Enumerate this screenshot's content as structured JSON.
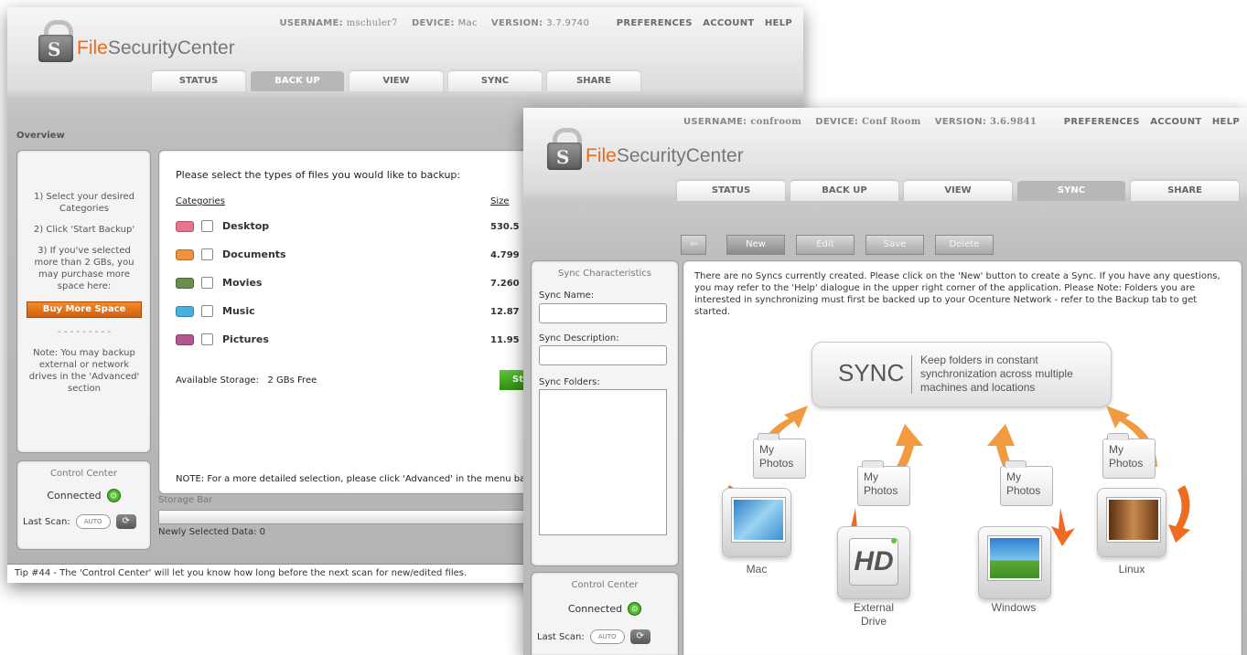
{
  "brand": {
    "prefix": "File",
    "suffix": "SecurityCenter"
  },
  "back_window": {
    "topbar": {
      "username_label": "USERNAME:",
      "username": "mschuler7",
      "device_label": "DEVICE:",
      "device": "Mac",
      "version_label": "VERSION:",
      "version": "3.7.9740",
      "preferences": "PREFERENCES",
      "account": "ACCOUNT",
      "help": "HELP"
    },
    "tabs": [
      "STATUS",
      "BACK UP",
      "VIEW",
      "SYNC",
      "SHARE"
    ],
    "active_tab": "BACK UP",
    "section_title": "Overview",
    "instructions": {
      "step1": "1) Select your desired Categories",
      "step2": "2) Click 'Start Backup'",
      "step3": "3) If you've selected more than 2 GBs, you may purchase more space here:",
      "buy_button": "Buy More Space",
      "divider": "- - - - - - - - -",
      "note": "Note: You may backup external or network drives in the 'Advanced' section"
    },
    "main": {
      "prompt": "Please select the types of files you would like to backup:",
      "categories_header": "Categories",
      "size_header": "Size",
      "categories": [
        {
          "name": "Desktop",
          "size": "530.5",
          "color": "#e8738f"
        },
        {
          "name": "Documents",
          "size": "4.799",
          "color": "#f0923d"
        },
        {
          "name": "Movies",
          "size": "7.260",
          "color": "#6a8d4e"
        },
        {
          "name": "Music",
          "size": "12.87",
          "color": "#46b2dc"
        },
        {
          "name": "Pictures",
          "size": "11.95",
          "color": "#b4558d"
        }
      ],
      "available_label": "Available Storage:",
      "available_value": "2 GBs Free",
      "start_button": "St",
      "note": "NOTE: For a more detailed selection, please click 'Advanced' in the menu bar al"
    },
    "control_center": {
      "title": "Control Center",
      "status": "Connected",
      "last_scan_label": "Last Scan:",
      "last_scan_value": "AUTO"
    },
    "storage_bar": {
      "title": "Storage Bar",
      "caption": "Newly Selected Data: 0"
    },
    "tip": "Tip #44 - The 'Control Center' will let you know how long before the next scan for new/edited files."
  },
  "front_window": {
    "topbar": {
      "username_label": "USERNAME:",
      "username": "confroom",
      "device_label": "DEVICE:",
      "device": "Conf Room",
      "version_label": "VERSION:",
      "version": "3.6.9841",
      "preferences": "PREFERENCES",
      "account": "ACCOUNT",
      "help": "HELP"
    },
    "tabs": [
      "STATUS",
      "BACK UP",
      "VIEW",
      "SYNC",
      "SHARE"
    ],
    "active_tab": "SYNC",
    "toolbar": {
      "new": "New",
      "edit": "Edit",
      "save": "Save",
      "delete": "Delete"
    },
    "sync_panel": {
      "title": "Sync Characteristics",
      "name_label": "Sync Name:",
      "description_label": "Sync Description:",
      "folders_label": "Sync Folders:"
    },
    "message": "There are no Syncs currently created. Please click on the 'New' button to create a Sync. If you have any questions, you may refer to the 'Help' dialogue in the upper right corner of the application. Please Note: Folders you are interested in synchronizing must first be backed up to your Ocenture Network - refer to the Backup tab to get started.",
    "diagram": {
      "title": "SYNC",
      "tagline": "Keep folders in constant synchronization across multiple machines and locations",
      "folder_label": "My Photos",
      "devices": [
        "Mac",
        "External Drive",
        "Windows",
        "Linux"
      ],
      "hd_text": "HD"
    },
    "control_center": {
      "title": "Control Center",
      "status": "Connected",
      "last_scan_label": "Last Scan:",
      "last_scan_value": "AUTO"
    }
  },
  "colors": {
    "accent": "#e66d1e",
    "connected": "#2f9b12",
    "start": "#3aa21c"
  }
}
